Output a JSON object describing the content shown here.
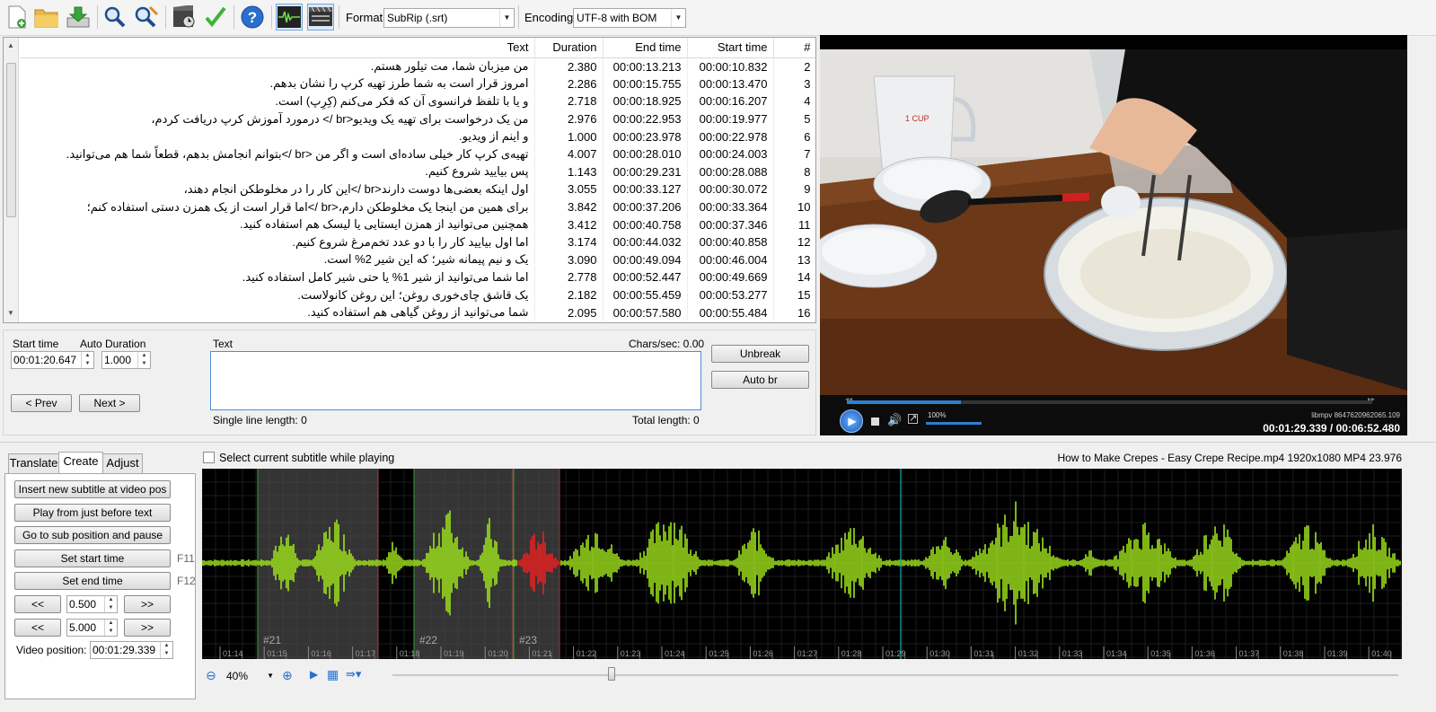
{
  "toolbar": {
    "icons": [
      "new-file-icon",
      "open-folder-icon",
      "save-download-icon",
      "find-icon",
      "replace-icon",
      "visual-sync-icon",
      "spell-check-icon",
      "help-icon",
      "waveform-toggle-icon",
      "video-toggle-icon"
    ],
    "format_label": "Format",
    "format_value": "SubRip (.srt)",
    "encoding_label": "Encoding",
    "encoding_value": "UTF-8 with BOM"
  },
  "grid": {
    "headers": {
      "text": "Text",
      "duration": "Duration",
      "end": "End time",
      "start": "Start time",
      "num": "#"
    },
    "rows": [
      {
        "text": "من میزبان شما، مت تیلور هستم.",
        "duration": "2.380",
        "end": "00:00:13.213",
        "start": "00:00:10.832",
        "num": "2"
      },
      {
        "text": "امروز قرار است به شما طرز تهیه کرپ را نشان بدهم.",
        "duration": "2.286",
        "end": "00:00:15.755",
        "start": "00:00:13.470",
        "num": "3"
      },
      {
        "text": "و یا با تلفظ فرانسوی آن که فکر می‌کنم (کِرِپ) است.",
        "duration": "2.718",
        "end": "00:00:18.925",
        "start": "00:00:16.207",
        "num": "4"
      },
      {
        "text": "من یک درخواست برای تهیه یک ویدیو<br /> درمورد آموزش کرپ دریافت کردم،",
        "duration": "2.976",
        "end": "00:00:22.953",
        "start": "00:00:19.977",
        "num": "5"
      },
      {
        "text": "و اینم از ویدیو.",
        "duration": "1.000",
        "end": "00:00:23.978",
        "start": "00:00:22.978",
        "num": "6"
      },
      {
        "text": "تهیه‌ی کرپ کار خیلی ساده‌ای است و اگر من <br />بتوانم انجامش بدهم، قطعاً شما هم می‌توانید.",
        "duration": "4.007",
        "end": "00:00:28.010",
        "start": "00:00:24.003",
        "num": "7"
      },
      {
        "text": "پس بیایید شروع کنیم.",
        "duration": "1.143",
        "end": "00:00:29.231",
        "start": "00:00:28.088",
        "num": "8"
      },
      {
        "text": "اول اینکه بعضی‌ها دوست دارند<br />این کار را در مخلوطکن انجام دهند،",
        "duration": "3.055",
        "end": "00:00:33.127",
        "start": "00:00:30.072",
        "num": "9"
      },
      {
        "text": "برای همین من اینجا یک مخلوطکن دارم،<br />اما قرار است از یک همزن دستی استفاده کنم؛",
        "duration": "3.842",
        "end": "00:00:37.206",
        "start": "00:00:33.364",
        "num": "10"
      },
      {
        "text": "همچنین می‌توانید از همزن ایستایی یا لیسک هم استفاده کنید.",
        "duration": "3.412",
        "end": "00:00:40.758",
        "start": "00:00:37.346",
        "num": "11"
      },
      {
        "text": "اما اول بیایید کار را با دو عدد تخم‌مرغ شروع کنیم.",
        "duration": "3.174",
        "end": "00:00:44.032",
        "start": "00:00:40.858",
        "num": "12"
      },
      {
        "text": "یک و نیم پیمانه شیر؛ که این شیر 2% است.",
        "duration": "3.090",
        "end": "00:00:49.094",
        "start": "00:00:46.004",
        "num": "13"
      },
      {
        "text": "اما شما می‌توانید از شیر 1% یا حتی شیر کامل استفاده کنید.",
        "duration": "2.778",
        "end": "00:00:52.447",
        "start": "00:00:49.669",
        "num": "14"
      },
      {
        "text": "یک قاشق چای‌خوری روغن؛ این روغن کانولاست.",
        "duration": "2.182",
        "end": "00:00:55.459",
        "start": "00:00:53.277",
        "num": "15"
      },
      {
        "text": "شما می‌توانید از روغن گیاهی هم استفاده کنید.",
        "duration": "2.095",
        "end": "00:00:57.580",
        "start": "00:00:55.484",
        "num": "16"
      }
    ]
  },
  "edit": {
    "start_time_label": "Start time",
    "start_time_value": "00:01:20.647",
    "auto_duration_label": "Auto Duration",
    "duration_value": "1.000",
    "text_label": "Text",
    "chars_sec": "Chars/sec: 0.00",
    "unbreak": "Unbreak",
    "auto_br": "Auto br",
    "prev": "< Prev",
    "next": "Next >",
    "single_line_length": "Single line length: 0",
    "total_length": "Total length: 0"
  },
  "player": {
    "volume_percent": "100%",
    "position_text": "00:01:29.339 / 00:06:52.480",
    "mpv_label": "libmpv 8647620962065.109",
    "progress_fraction": 0.217
  },
  "tabs": [
    "Translate",
    "Create",
    "Adjust"
  ],
  "create_panel": {
    "insert_new": "Insert new subtitle at video pos",
    "play_before": "Play from just before text",
    "go_to_sub": "Go to sub position and pause",
    "set_start": "Set start time",
    "set_start_key": "F11",
    "set_end": "Set end time",
    "set_end_key": "F12",
    "back_label": "<<",
    "forward_label": ">>",
    "step_small": "0.500",
    "step_large": "5.000",
    "video_position_label": "Video position:",
    "video_position_value": "00:01:29.339"
  },
  "waveform": {
    "select_current_label": "Select current subtitle while playing",
    "file_info": "How to Make Crepes - Easy Crepe Recipe.mp4 1920x1080 MP4 23.976",
    "time_ticks": [
      "01:14",
      "01:15",
      "01:16",
      "01:17",
      "01:18",
      "01:19",
      "01:20",
      "01:21",
      "01:22",
      "01:23",
      "01:24",
      "01:25",
      "01:26",
      "01:27",
      "01:28",
      "01:29",
      "01:30",
      "01:31",
      "01:32",
      "01:33",
      "01:34",
      "01:35",
      "01:36",
      "01:37",
      "01:38",
      "01:39",
      "01:40"
    ],
    "subtitle_labels": [
      "#21",
      "#22",
      "#23"
    ],
    "zoom": "40%"
  },
  "colors": {
    "wave": "#9ee21b",
    "wave_selected": "#e82020",
    "selection_bg": "#4a4a4a",
    "cursor": "#1ad0c8"
  }
}
